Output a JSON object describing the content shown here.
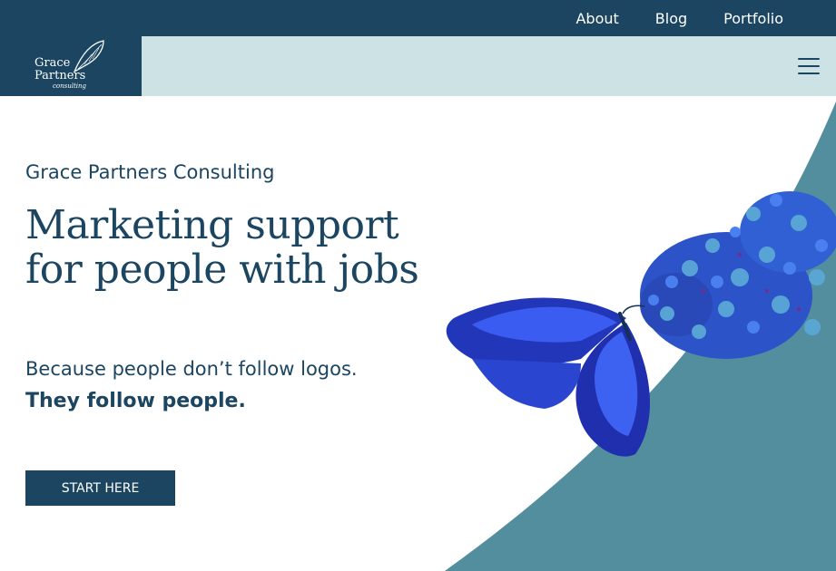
{
  "nav": {
    "links": [
      {
        "label": "About"
      },
      {
        "label": "Blog"
      },
      {
        "label": "Portfolio"
      }
    ]
  },
  "logo": {
    "line1": "Grace",
    "line2": "Partners",
    "sub": "consulting"
  },
  "hero": {
    "eyebrow": "Grace Partners Consulting",
    "headline": "Marketing support for people with jobs",
    "tagline": "Because people don’t follow logos.",
    "tagline_bold": "They follow people.",
    "cta_label": "START HERE"
  },
  "colors": {
    "navy": "#1b4560",
    "light_teal": "#cde2e5",
    "teal": "#528e9d",
    "butterfly_blue": "#2f4fd8",
    "flower_blue": "#3d6fe0"
  },
  "icons": {
    "menu": "hamburger-icon",
    "logo_mark": "butterfly-wing-icon"
  }
}
